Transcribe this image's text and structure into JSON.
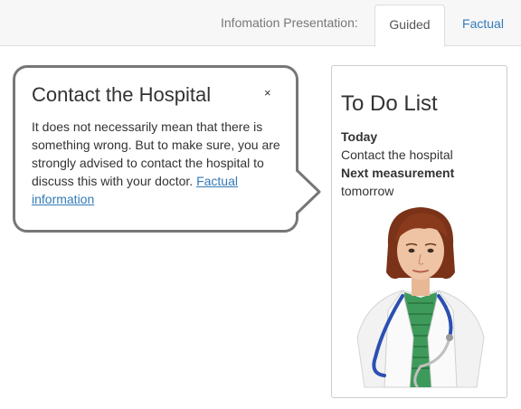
{
  "header": {
    "nav_label": "Infomation Presentation:",
    "tabs": [
      {
        "label": "Guided",
        "active": true
      },
      {
        "label": "Factual",
        "active": false
      }
    ]
  },
  "bubble": {
    "title": "Contact the Hospital",
    "close_label": "×",
    "body_text": "It does not necessarily mean that there is something wrong. But to make sure, you are strongly advised to contact the hospital to discuss this with your doctor. ",
    "link_text": "Factual information"
  },
  "todo": {
    "title": "To Do List",
    "sections": [
      {
        "heading": "Today",
        "item": "Contact the hospital"
      },
      {
        "heading": "Next measurement",
        "item": "tomorrow"
      }
    ]
  },
  "colors": {
    "accent": "#337ab7",
    "bubble_border": "#777777",
    "navbar_bg": "#f7f7f7"
  },
  "icons": {
    "avatar": "doctor-avatar-icon"
  }
}
